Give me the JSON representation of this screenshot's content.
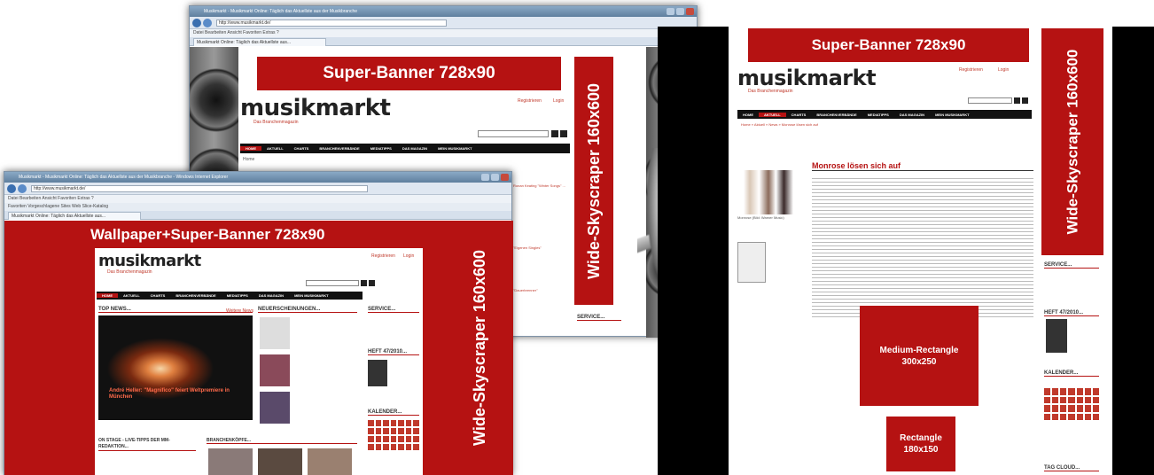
{
  "ads": {
    "super_banner_1": "Super-Banner   728x90",
    "skyscraper_1": "Wide-Skyscraper 160x600",
    "wallpaper_banner": "Wallpaper+Super-Banner   728x90",
    "skyscraper_2": "Wide-Skyscraper 160x600",
    "super_banner_2": "Super-Banner   728x90",
    "skyscraper_3": "Wide-Skyscraper 160x600",
    "medium_rect_line1": "Medium-Rectangle",
    "medium_rect_line2": "300x250",
    "rect_line1": "Rectangle",
    "rect_line2": "180x150"
  },
  "site": {
    "logo": "musikmarkt",
    "logo_sub": "Das Branchenmagazin",
    "register": "Registrieren",
    "login": "Login",
    "nav": [
      "HOME",
      "AKTUELL",
      "CHARTS",
      "BRANCHENVERBÄNDE",
      "MEDIATIPPS",
      "DAS MAGAZIN",
      "MEIN MUSIKMARKT"
    ],
    "sidebar": {
      "service": "SERVICE...",
      "heft": "HEFT 47/2010...",
      "kalender": "KALENDER...",
      "tagcloud": "TAG CLOUD..."
    }
  },
  "window_back": {
    "title": "Musikmarkt - Musikmarkt Online: Täglich das Aktuellste aus der Musikbranche",
    "url": "http://www.musikmarkt.de/",
    "tab": "Musikmarkt Online: Täglich das Aktuellste aus...",
    "menu": "Datei   Bearbeiten   Ansicht   Favoriten   Extras   ?",
    "crumb": "Home",
    "sidebar_texts": [
      "Ronan Keating \"Winter Songs\" ...",
      "\"Eigenen Singles\"",
      "\"Dauerbrenner\""
    ]
  },
  "window_front": {
    "title": "Musikmarkt - Musikmarkt Online: Täglich das Aktuellste aus der Musikbranche - Windows Internet Explorer",
    "url": "http://www.musikmarkt.de/",
    "tab": "Musikmarkt Online: Täglich das Aktuellste aus...",
    "menu": "Datei   Bearbeiten   Ansicht   Favoriten   Extras   ?",
    "favorites": "Favoriten   Vorgeschlagene Sites   Web Slice-Katalog",
    "top_news": "TOP NEWS...",
    "top_news_more": "Weitere News",
    "neu": "NEUERSCHEINUNGEN...",
    "headline": "André Heller: \"Magnifico\" feiert Weltpremiere in München",
    "on_stage": "ON STAGE - LIVE-TIPPS DER MM-REDAKTION...",
    "branchen": "BRANCHENKÖPFE..."
  },
  "article": {
    "breadcrumb": "Home  »  Aktuell  »  News  »  Monrose lösen sich auf",
    "headline": "Monrose lösen sich auf",
    "caption": "Monrose (Bild: Warner Music)"
  },
  "colors": {
    "brand_red": "#b51212",
    "nav_black": "#111111"
  }
}
